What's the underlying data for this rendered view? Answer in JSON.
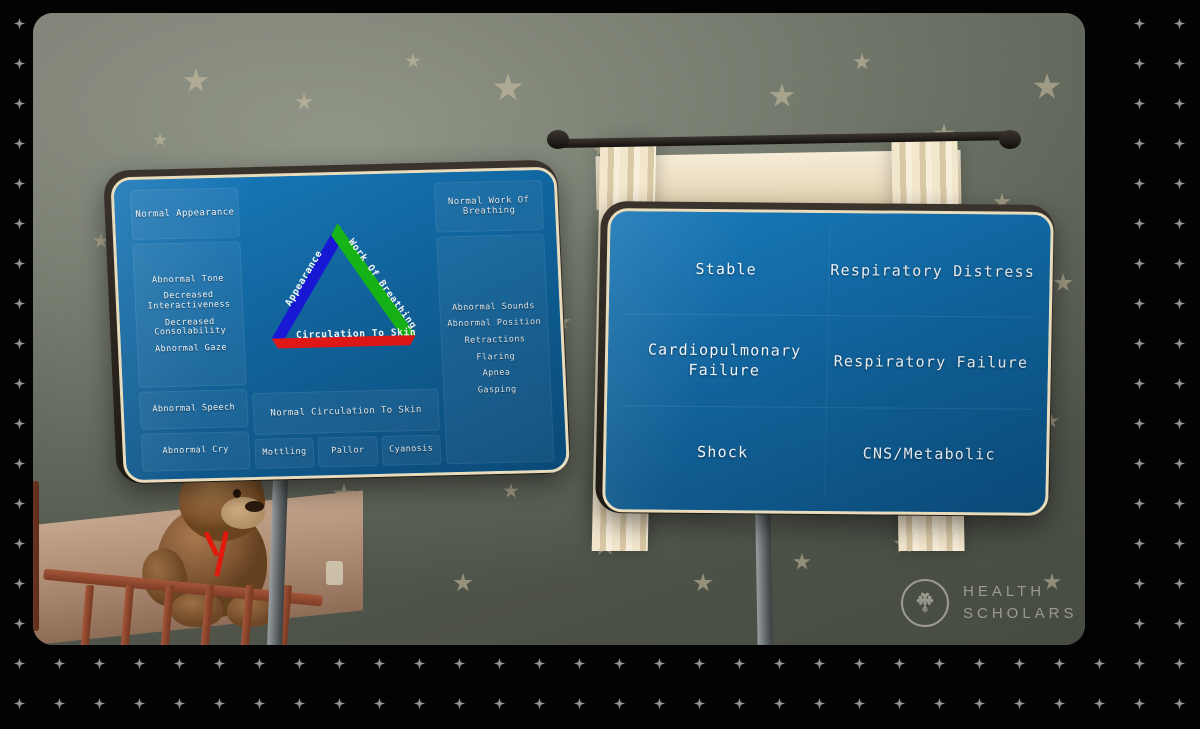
{
  "app": {
    "watermark_line1": "HEALTH",
    "watermark_line2": "SCHOLARS",
    "logo_icon": "tree-in-circle-icon"
  },
  "scene": {
    "description": "nursery room with teddy bear in crib, window with curtains, star-patterned wall",
    "wall_color": "#7c8373",
    "star_color": "#cfc3a4",
    "teddy_bow_color": "#e01a0c"
  },
  "left_board": {
    "name": "pediatric-assessment-triangle-board",
    "appearance_column": {
      "header": "Normal Appearance",
      "abnormal_group": [
        "Abnormal Tone",
        "Decreased Interactiveness",
        "Decreased Consolability",
        "Abnormal Gaze"
      ],
      "abnormal_speech": "Abnormal Speech",
      "abnormal_cry": "Abnormal Cry"
    },
    "triangle": {
      "left_edge_label": "Appearance",
      "left_edge_color": "#1414d8",
      "right_edge_label": "Work Of Breathing",
      "right_edge_color": "#14b814",
      "bottom_edge_label": "Circulation To Skin",
      "bottom_edge_color": "#e51414"
    },
    "circulation_column": {
      "header": "Normal Circulation To Skin",
      "signs": [
        "Mottling",
        "Pallor",
        "Cyanosis"
      ]
    },
    "breathing_column": {
      "header": "Normal Work Of Breathing",
      "signs": [
        "Abnormal Sounds",
        "Abnormal Position",
        "Retractions",
        "Flaring",
        "Apnea",
        "Gasping"
      ]
    }
  },
  "right_board": {
    "name": "assessment-outcome-board",
    "cells": [
      "Stable",
      "Respiratory Distress",
      "Cardiopulmonary Failure",
      "Respiratory Failure",
      "Shock",
      "CNS/Metabolic"
    ]
  }
}
